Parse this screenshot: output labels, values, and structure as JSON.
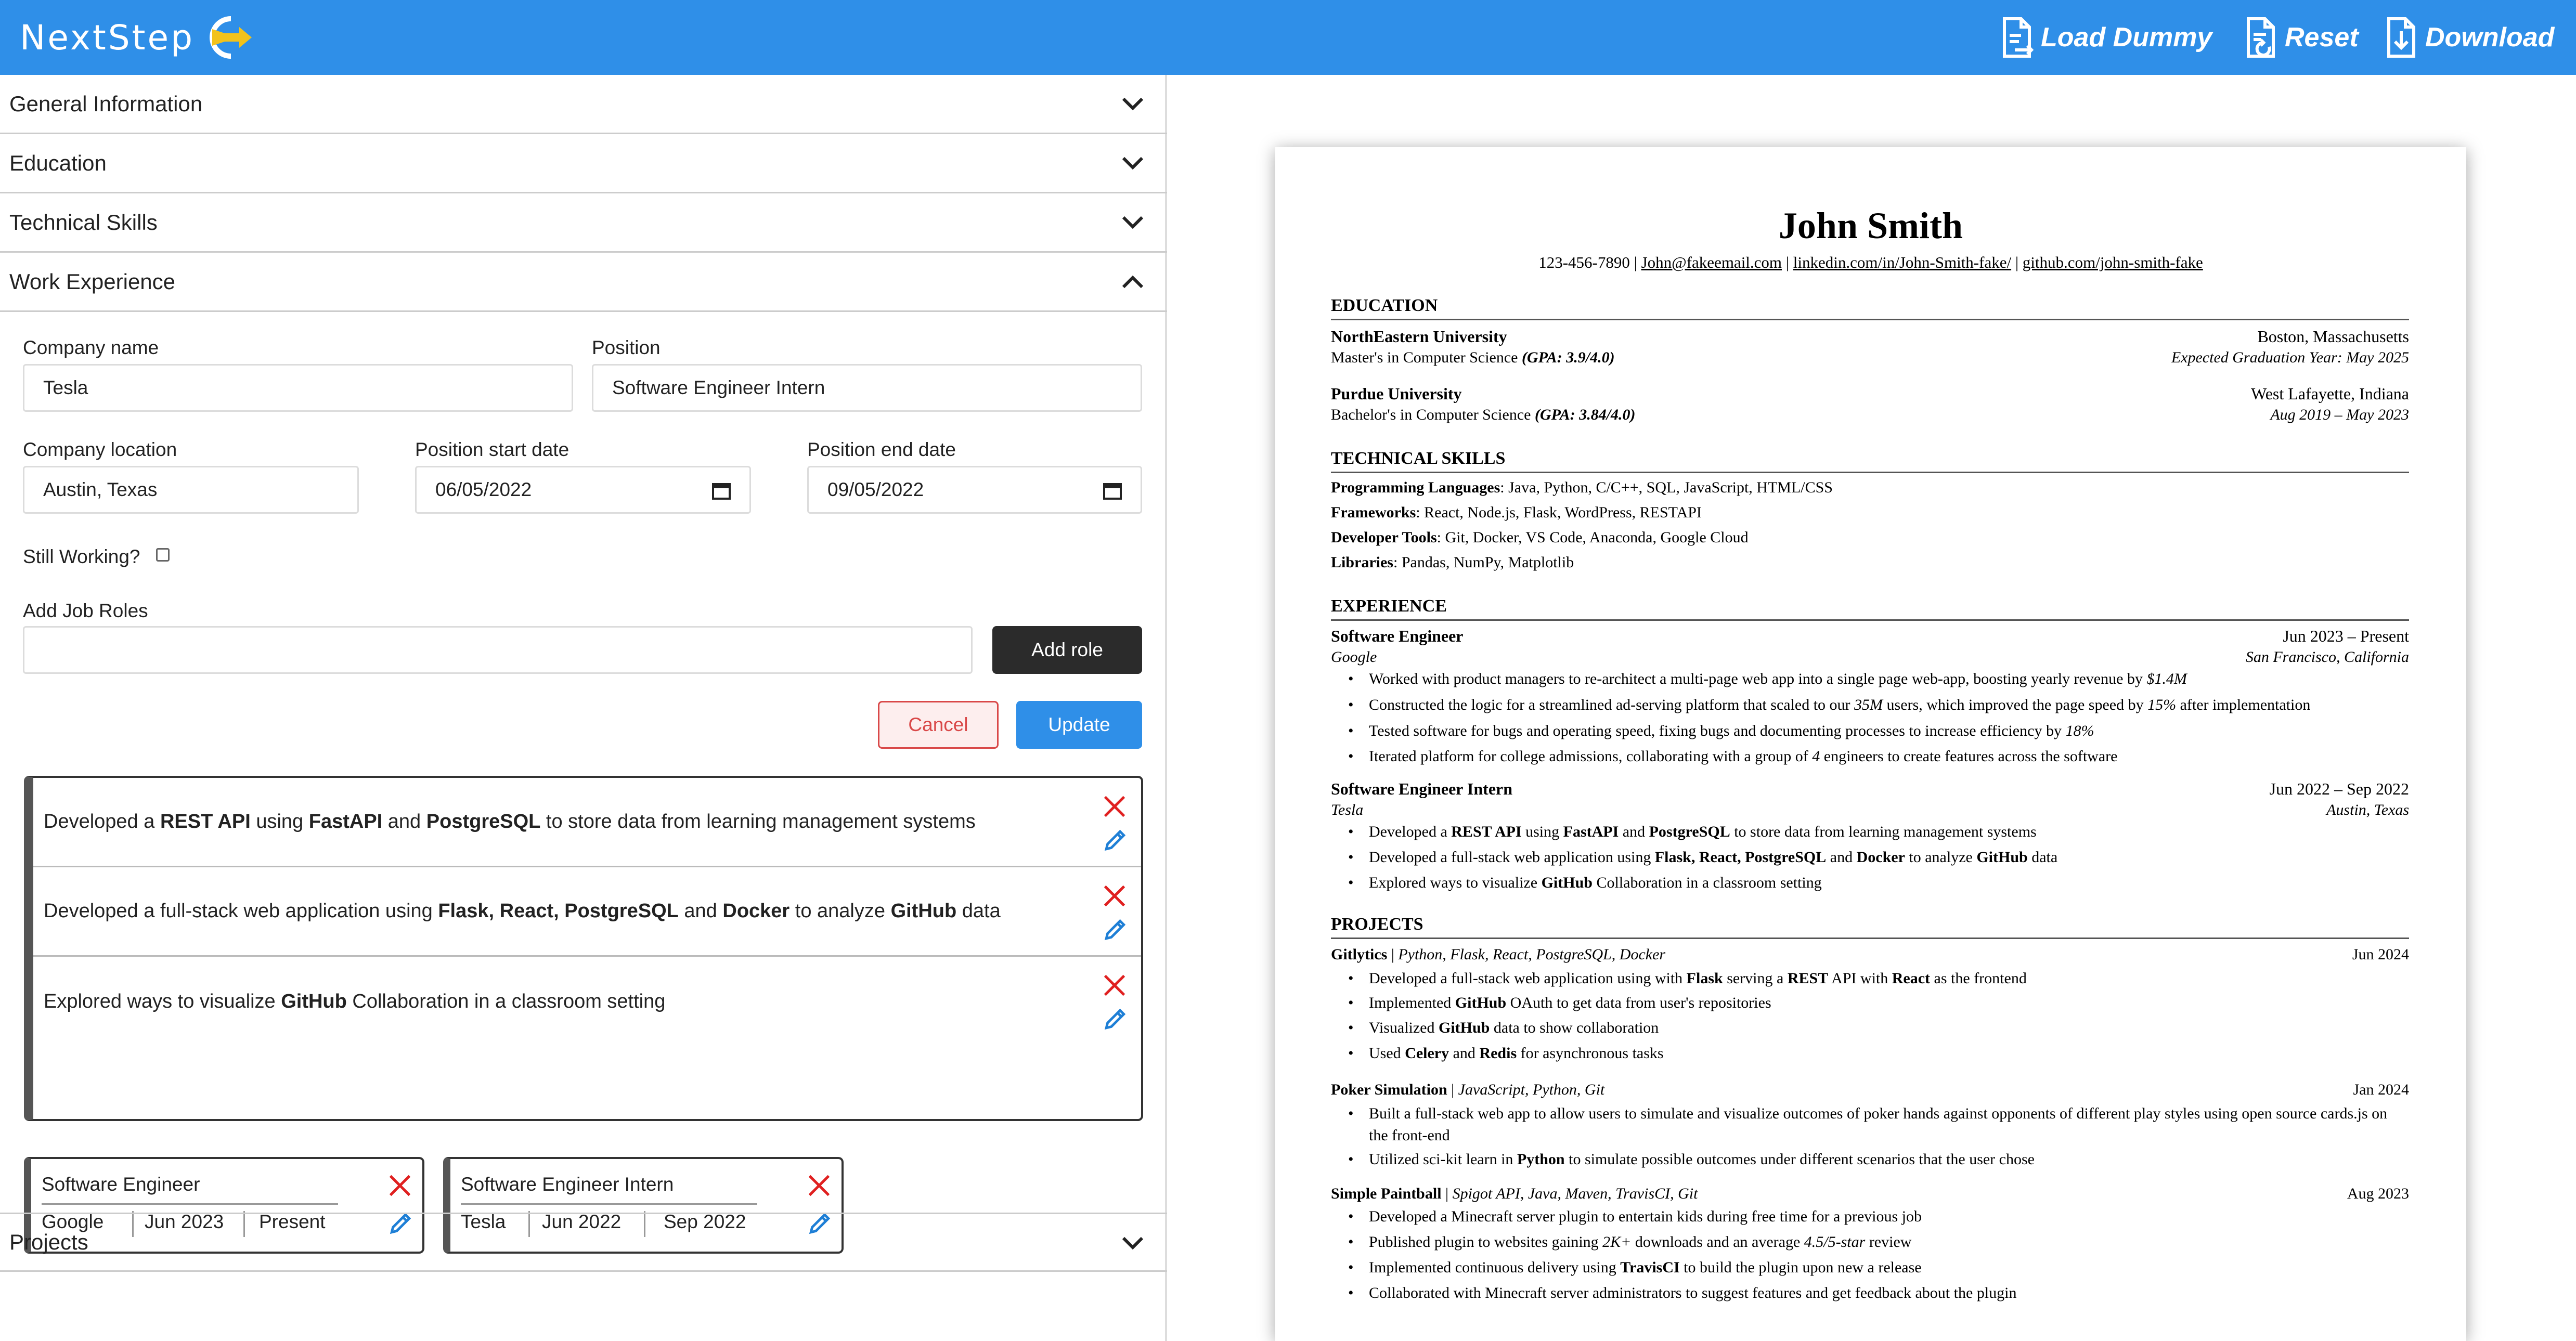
{
  "header": {
    "logo_text": "NextStep",
    "load_dummy": "Load Dummy",
    "reset": "Reset",
    "download": "Download",
    "bg_color": "#2f8fe8"
  },
  "sections": {
    "general": "General Information",
    "education": "Education",
    "skills": "Technical Skills",
    "work": "Work Experience",
    "projects": "Projects"
  },
  "form": {
    "company_name_label": "Company name",
    "company_name_value": "Tesla",
    "position_label": "Position",
    "position_value": "Software Engineer Intern",
    "location_label": "Company location",
    "location_value": "Austin, Texas",
    "start_label": "Position start date",
    "start_value": "06/05/2022",
    "end_label": "Position end date",
    "end_value": "09/05/2022",
    "still_working_label": "Still Working?",
    "still_working": false,
    "add_roles_label": "Add Job Roles",
    "add_roles_value": "",
    "add_role_button": "Add role",
    "cancel_button": "Cancel",
    "update_button": "Update"
  },
  "roles": [
    {
      "parts": [
        [
          "Developed a ",
          false
        ],
        [
          "REST API",
          true
        ],
        [
          " using ",
          false
        ],
        [
          "FastAPI",
          true
        ],
        [
          " and ",
          false
        ],
        [
          "PostgreSQL",
          true
        ],
        [
          " to store data from learning management systems",
          false
        ]
      ]
    },
    {
      "parts": [
        [
          "Developed a full-stack web application using ",
          false
        ],
        [
          "Flask, React, PostgreSQL",
          true
        ],
        [
          " and ",
          false
        ],
        [
          "Docker",
          true
        ],
        [
          " to analyze ",
          false
        ],
        [
          "GitHub",
          true
        ],
        [
          " data",
          false
        ]
      ]
    },
    {
      "parts": [
        [
          "Explored ways to visualize ",
          false
        ],
        [
          "GitHub",
          true
        ],
        [
          " Collaboration in a classroom setting",
          false
        ]
      ]
    }
  ],
  "experience_cards": [
    {
      "title": "Software Engineer",
      "company": "Google",
      "start": "Jun 2023",
      "end": "Present"
    },
    {
      "title": "Software Engineer Intern",
      "company": "Tesla",
      "start": "Jun 2022",
      "end": "Sep 2022"
    }
  ],
  "resume": {
    "name": "John Smith",
    "phone": "123-456-7890",
    "email": "John@fakeemail.com",
    "linkedin": "linkedin.com/in/John-Smith-fake/",
    "github": "github.com/john-smith-fake",
    "sep": " | ",
    "education_title": "EDUCATION",
    "education": [
      {
        "school": "NorthEastern University",
        "location": "Boston, Massachusetts",
        "degree": "Master's in Computer Science ",
        "gpa": "(GPA: 3.9/4.0)",
        "date": "Expected Graduation Year: May 2025"
      },
      {
        "school": "Purdue University",
        "location": "West Lafayette, Indiana",
        "degree": "Bachelor's in Computer Science ",
        "gpa": "(GPA: 3.84/4.0)",
        "date": "Aug 2019 – May 2023"
      }
    ],
    "skills_title": "TECHNICAL SKILLS",
    "skills": [
      {
        "label": "Programming Languages",
        "value": ": Java, Python, C/C++, SQL, JavaScript, HTML/CSS"
      },
      {
        "label": "Frameworks",
        "value": ": React, Node.js, Flask, WordPress, RESTAPI"
      },
      {
        "label": "Developer Tools",
        "value": ": Git, Docker, VS Code, Anaconda, Google Cloud"
      },
      {
        "label": "Libraries",
        "value": ": Pandas, NumPy, Matplotlib"
      }
    ],
    "experience_title": "EXPERIENCE",
    "experience": [
      {
        "position": "Software Engineer",
        "dates": "Jun 2023 – Present",
        "company": "Google",
        "location": "San Francisco, California",
        "bullets": [
          [
            [
              "Worked with product managers to re-architect a multi-page web app into a single page web-app, boosting yearly revenue by ",
              ""
            ],
            [
              "$1.4M",
              "i"
            ]
          ],
          [
            [
              "Constructed the logic for a streamlined ad-serving platform that scaled to our ",
              ""
            ],
            [
              "35M",
              "i"
            ],
            [
              " users, which improved the page speed by ",
              ""
            ],
            [
              "15%",
              "i"
            ],
            [
              " after implementation",
              ""
            ]
          ],
          [
            [
              "Tested software for bugs and operating speed, fixing bugs and documenting processes to increase efficiency by ",
              ""
            ],
            [
              "18%",
              "i"
            ]
          ],
          [
            [
              "Iterated platform for college admissions, collaborating with a group of ",
              ""
            ],
            [
              "4",
              "i"
            ],
            [
              " engineers to create features across the software",
              ""
            ]
          ]
        ]
      },
      {
        "position": "Software Engineer Intern",
        "dates": "Jun 2022 – Sep 2022",
        "company": "Tesla",
        "location": "Austin, Texas",
        "bullets": [
          [
            [
              "Developed a ",
              ""
            ],
            [
              "REST API",
              "b"
            ],
            [
              " using ",
              ""
            ],
            [
              "FastAPI",
              "b"
            ],
            [
              " and ",
              ""
            ],
            [
              "PostgreSQL",
              "b"
            ],
            [
              " to store data from learning management systems",
              ""
            ]
          ],
          [
            [
              "Developed a full-stack web application using ",
              ""
            ],
            [
              "Flask, React, PostgreSQL",
              "b"
            ],
            [
              " and ",
              ""
            ],
            [
              "Docker",
              "b"
            ],
            [
              " to analyze ",
              ""
            ],
            [
              "GitHub",
              "b"
            ],
            [
              " data",
              ""
            ]
          ],
          [
            [
              "Explored ways to visualize ",
              ""
            ],
            [
              "GitHub",
              "b"
            ],
            [
              " Collaboration in a classroom setting",
              ""
            ]
          ]
        ]
      }
    ],
    "projects_title": "PROJECTS",
    "projects": [
      {
        "name": "Gitlytics",
        "tech": "Python, Flask, React, PostgreSQL, Docker",
        "date": "Jun 2024",
        "bullets": [
          [
            [
              "Developed a full-stack web application using with ",
              ""
            ],
            [
              "Flask",
              "b"
            ],
            [
              " serving a ",
              ""
            ],
            [
              "REST",
              "b"
            ],
            [
              " API with ",
              ""
            ],
            [
              "React",
              "b"
            ],
            [
              " as the frontend",
              ""
            ]
          ],
          [
            [
              "Implemented ",
              ""
            ],
            [
              "GitHub",
              "b"
            ],
            [
              " OAuth to get data from user's repositories",
              ""
            ]
          ],
          [
            [
              "Visualized ",
              ""
            ],
            [
              "GitHub",
              "b"
            ],
            [
              " data to show collaboration",
              ""
            ]
          ],
          [
            [
              "Used ",
              ""
            ],
            [
              "Celery",
              "b"
            ],
            [
              " and ",
              ""
            ],
            [
              "Redis",
              "b"
            ],
            [
              " for asynchronous tasks",
              ""
            ]
          ]
        ]
      },
      {
        "name": "Poker Simulation",
        "tech": "JavaScript, Python, Git",
        "date": "Jan 2024",
        "bullets": [
          [
            [
              "Built a full-stack web app to allow users to simulate and visualize outcomes of poker hands against opponents of different play styles using open source cards.js on the front-end",
              ""
            ]
          ],
          [
            [
              "Utilized sci-kit learn in ",
              ""
            ],
            [
              "Python",
              "b"
            ],
            [
              " to simulate possible outcomes under different scenarios that the user chose",
              ""
            ]
          ]
        ]
      },
      {
        "name": "Simple Paintball",
        "tech": "Spigot API, Java, Maven, TravisCI, Git",
        "date": "Aug 2023",
        "bullets": [
          [
            [
              "Developed a Minecraft server plugin to entertain kids during free time for a previous job",
              ""
            ]
          ],
          [
            [
              "Published plugin to websites gaining ",
              ""
            ],
            [
              "2K+",
              "i"
            ],
            [
              " downloads and an average ",
              ""
            ],
            [
              "4.5/5-star",
              "i"
            ],
            [
              " review",
              ""
            ]
          ],
          [
            [
              "Implemented continuous delivery using ",
              ""
            ],
            [
              "TravisCI",
              "b"
            ],
            [
              " to build the plugin upon new a release",
              ""
            ]
          ],
          [
            [
              "Collaborated with Minecraft server administrators to suggest features and get feedback about the plugin",
              ""
            ]
          ]
        ]
      }
    ]
  }
}
